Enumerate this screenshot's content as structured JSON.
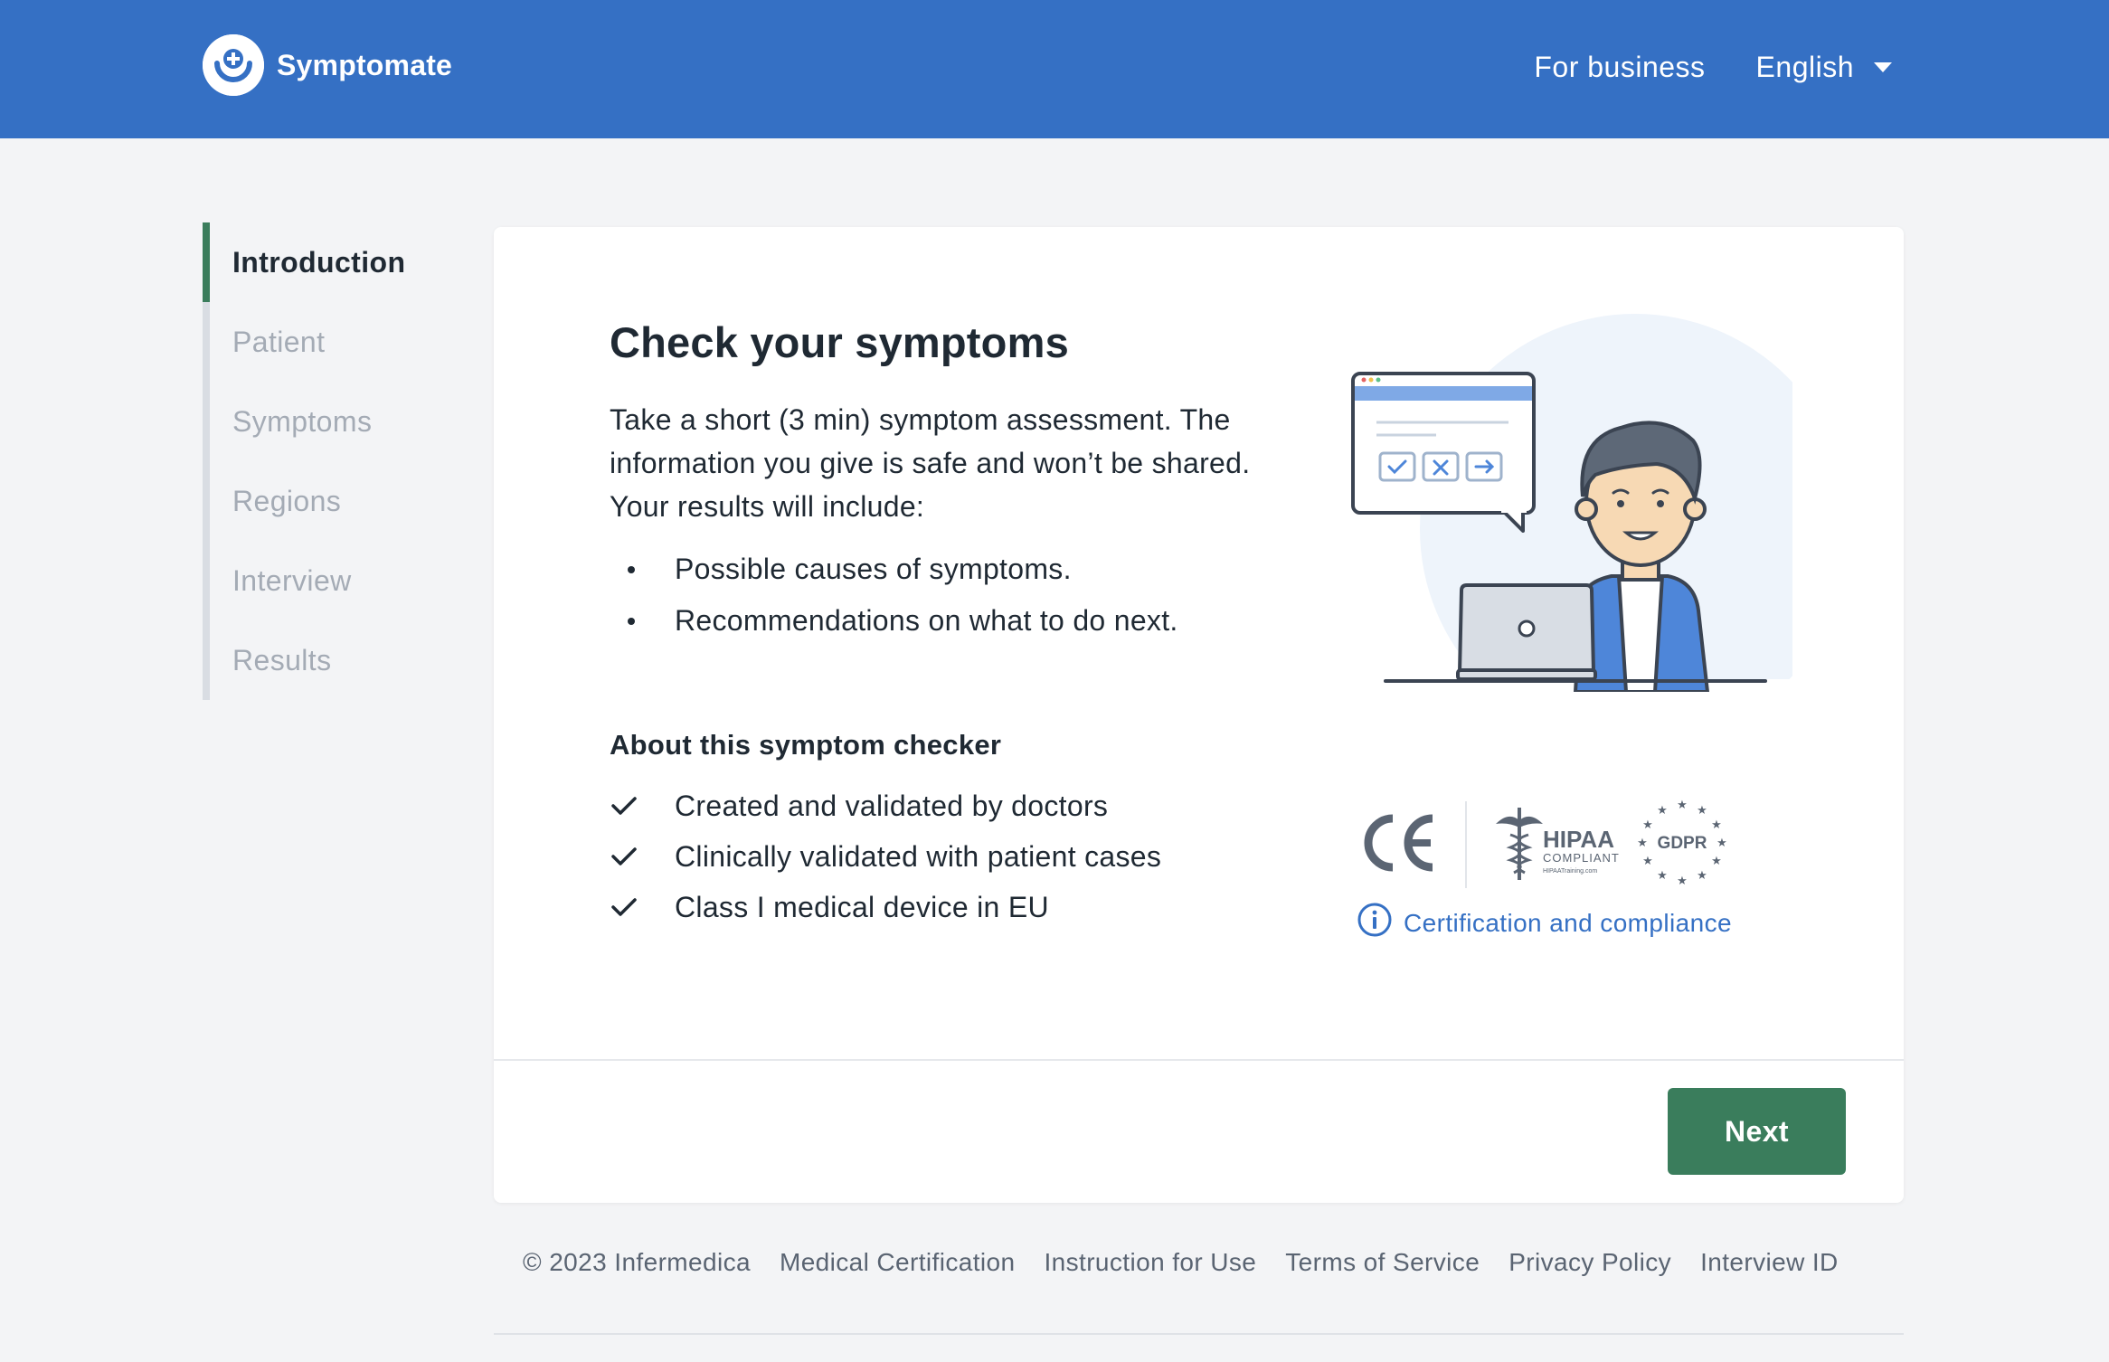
{
  "header": {
    "brand": "Symptomate",
    "for_business": "For business",
    "language": "English"
  },
  "steps": [
    {
      "label": "Introduction",
      "active": true
    },
    {
      "label": "Patient",
      "active": false
    },
    {
      "label": "Symptoms",
      "active": false
    },
    {
      "label": "Regions",
      "active": false
    },
    {
      "label": "Interview",
      "active": false
    },
    {
      "label": "Results",
      "active": false
    }
  ],
  "main": {
    "title": "Check your symptoms",
    "intro": "Take a short (3 min) symptom assessment. The information you give is safe and won’t be shared. Your results will include:",
    "bullets": [
      "Possible causes of symptoms.",
      "Recommendations on what to do next."
    ],
    "about_title": "About this symptom checker",
    "checks": [
      "Created and validated by doctors",
      "Clinically validated with patient cases",
      "Class I medical device in EU"
    ],
    "badges": {
      "hipaa": "HIPAA",
      "hipaa_sub": "COMPLIANT",
      "hipaa_site": "HIPAATraining.com",
      "gdpr": "GDPR"
    },
    "cert_link": "Certification and compliance",
    "next": "Next"
  },
  "footer": {
    "copyright": "© 2023 Infermedica",
    "links": [
      "Medical Certification",
      "Instruction for Use",
      "Terms of Service",
      "Privacy Policy",
      "Interview ID"
    ]
  },
  "colors": {
    "header_bg": "#3570c4",
    "accent_green": "#3a7d5c",
    "link_blue": "#3570c4",
    "page_bg": "#f3f4f6"
  }
}
